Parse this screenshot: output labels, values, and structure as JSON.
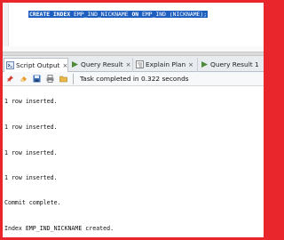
{
  "editor": {
    "sql": {
      "kw1": "CREATE INDEX",
      "name": " EMP_IND_NICKNAME ",
      "kw2": "ON",
      "rest": " EMP_IND (NICKNAME);"
    }
  },
  "tabs": [
    {
      "label": "Script Output",
      "icon": "script-output-icon",
      "active": true
    },
    {
      "label": "Query Result",
      "icon": "query-result-icon",
      "active": false
    },
    {
      "label": "Explain Plan",
      "icon": "explain-plan-icon",
      "active": false
    },
    {
      "label": "Query Result 1",
      "icon": "query-result-icon",
      "active": false
    }
  ],
  "toolbar": {
    "icons": [
      "pin-icon",
      "eraser-icon",
      "save-icon",
      "print-icon",
      "open-file-icon"
    ],
    "status": "Task completed in 0.322 seconds"
  },
  "output": {
    "lines": [
      "1 row inserted.",
      "1 row inserted.",
      "1 row inserted.",
      "1 row inserted.",
      "Commit complete.",
      "Index EMP_IND_NICKNAME created."
    ]
  },
  "colors": {
    "frame": "#e8262b",
    "selection": "#1f5fbf"
  }
}
